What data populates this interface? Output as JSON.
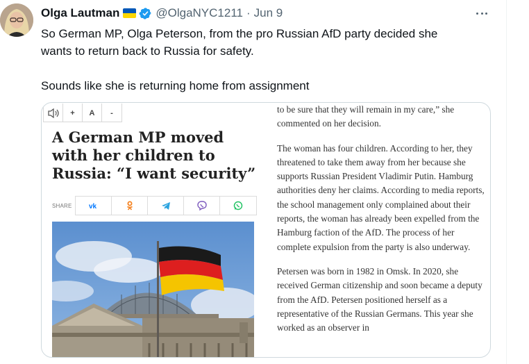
{
  "tweet": {
    "author_name": "Olga Lautman",
    "handle": "@OlgaNYC1211",
    "separator": "·",
    "date": "Jun 9",
    "text_lines": [
      "So German MP, Olga Peterson, from the pro Russian AfD party decided she",
      "wants to return back to Russia for safety."
    ],
    "text_second": "Sounds like she is returning home from assignment",
    "colors": {
      "text": "#0f1419",
      "muted": "#536471",
      "verified": "#1d9bf0"
    },
    "icons": [
      "ukraine-flag-icon",
      "verified-badge-icon",
      "more-options-icon"
    ]
  },
  "card": {
    "toolbar": {
      "plus": "+",
      "font": "A",
      "minus": "-"
    },
    "headline": "A German MP moved with her children to Russia: “I want security”",
    "share_label": "SHARE",
    "share_icons": [
      "vk-icon",
      "odnoklassniki-icon",
      "telegram-icon",
      "viber-icon",
      "whatsapp-icon"
    ],
    "share_colors": [
      "#0077ff",
      "#f58220",
      "#2aa3df",
      "#7d5bbe",
      "#25c466"
    ],
    "article_paragraphs": [
      "to be sure that they will remain in my care,” she commented on her decision.",
      "The woman has four children. According to her, they threatened to take them away from her because she supports Russian President Vladimir Putin. Hamburg authorities deny her claims. According to media reports, the school management only complained about their reports, the woman has already been expelled from the Hamburg faction of the AfD. The process of her complete expulsion from the party is also underway.",
      "Petersen was born in 1982 in Omsk. In 2020, she received German citizenship and soon became a deputy from the AfD. Petersen positioned herself as a representative of the Russian Germans. This year she worked as an observer in"
    ]
  }
}
